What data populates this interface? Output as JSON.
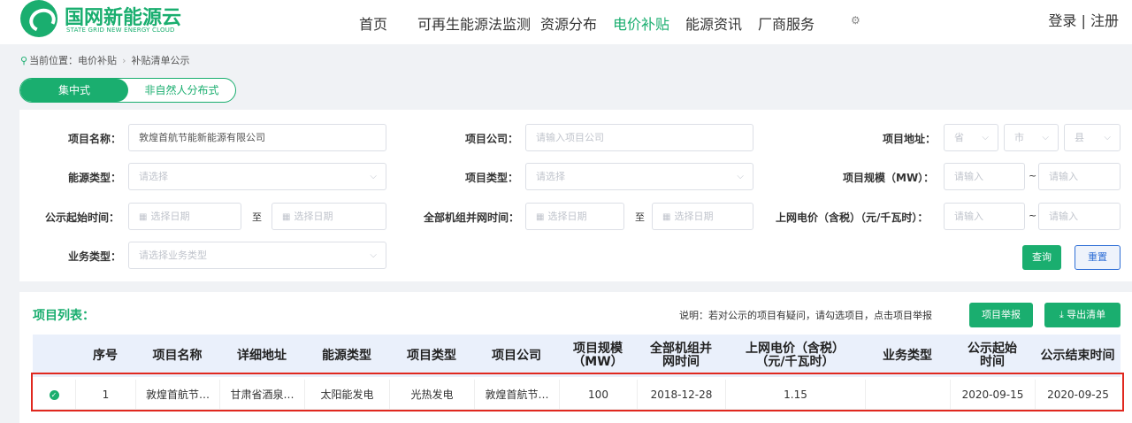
{
  "header": {
    "logo_cn": "国网新能源云",
    "logo_en": "STATE GRID NEW ENERGY CLOUD",
    "nav": [
      "首页",
      "可再生能源法监测",
      "资源分布",
      "电价补贴",
      "能源资讯",
      "厂商服务"
    ],
    "active_nav": "电价补贴",
    "auth": "登录 | 注册"
  },
  "breadcrumb": {
    "prefix": "当前位置：电价补贴",
    "current": "补贴清单公示"
  },
  "tabs": [
    "集中式",
    "非自然人分布式"
  ],
  "filter": {
    "project_name_label": "项目名称：",
    "project_name_value": "敦煌首航节能新能源有限公司",
    "project_company_label": "项目公司：",
    "project_company_placeholder": "请输入项目公司",
    "project_address_label": "项目地址：",
    "province_placeholder": "省",
    "city_placeholder": "市",
    "county_placeholder": "县",
    "energy_type_label": "能源类型：",
    "energy_type_placeholder": "请选择",
    "project_type_label": "项目类型：",
    "project_type_placeholder": "请选择",
    "scale_label": "项目规模（MW）：",
    "range_placeholder": "请输入",
    "range_sep": "~",
    "publicity_start_label": "公示起始时间：",
    "date_placeholder": "选择日期",
    "to": "至",
    "grid_time_label": "全部机组并网时间：",
    "price_label": "上网电价（含税）（元/千瓦时）：",
    "business_type_label": "业务类型：",
    "business_type_placeholder": "请选择业务类型",
    "query_button": "查询",
    "reset_button": "重置"
  },
  "list": {
    "title": "项目列表：",
    "note": "说明：若对公示的项目有疑问，请勾选项目，点击项目举报",
    "report_button": "项目举报",
    "export_button": "导出清单",
    "columns": [
      "",
      "序号",
      "项目名称",
      "详细地址",
      "能源类型",
      "项目类型",
      "项目公司",
      "项目规模（MW）",
      "全部机组并网时间",
      "上网电价（含税）（元/千瓦时）",
      "业务类型",
      "公示起始时间",
      "公示结束时间"
    ],
    "rows": [
      {
        "index": "1",
        "name": "敦煌首航节…",
        "address": "甘肃省酒泉…",
        "energy_type": "太阳能发电",
        "project_type": "光热发电",
        "company": "敦煌首航节…",
        "scale": "100",
        "grid_time": "2018-12-28",
        "price": "1.15",
        "business_type": "",
        "start": "2020-09-15",
        "end": "2020-09-25"
      }
    ]
  },
  "colors": {
    "accent": "#1aae6f",
    "highlight": "#e0281f",
    "link_blue": "#2f6fd6"
  }
}
